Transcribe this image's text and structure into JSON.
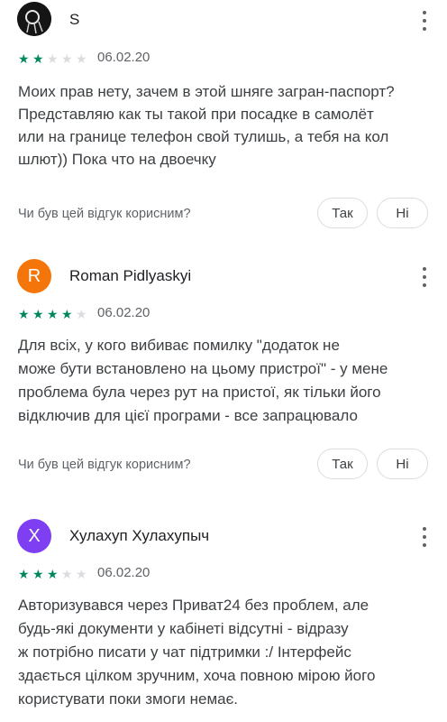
{
  "reviews": [
    {
      "author": "S",
      "avatar_letter": "",
      "avatar_color": "#1f1f1f",
      "rating": 2,
      "date": "06.02.20",
      "text": "Моих прав нету, зачем в этой шняге загран-паспорт?\nПредставляю как ты такой при посадке в самолёт\nили на границе телефон свой тулишь, а тебя на кол\nшлют)) Пока что на двоечку",
      "helpful_question": "Чи був цей відгук корисним?",
      "yes_label": "Так",
      "no_label": "Ні"
    },
    {
      "author": "Roman Pidlyaskyi",
      "avatar_letter": "R",
      "avatar_color": "#f4760b",
      "rating": 4,
      "date": "06.02.20",
      "text": "Для всіх, у кого вибиває помилку \"додаток не\nможе бути встановлено на цьому пристрої\" - у мене\nпроблема була через рут на пристої, як тільки його\nвідключив для цієї програми - все запрацювало",
      "helpful_question": "Чи був цей відгук корисним?",
      "yes_label": "Так",
      "no_label": "Ні"
    },
    {
      "author": "Хулахуп Хулахупыч",
      "avatar_letter": "X",
      "avatar_color": "#7e3ff2",
      "rating": 3,
      "date": "06.02.20",
      "text": "Авторизувався через Приват24 без проблем, але\nбудь-які документи у кабінеті відсутні - відразу\nж потрібно писати у чат підтримки :/ Інтерфейс\nздається цілком зручним, хоча повною мірою його\nкористувати поки змоги немає."
    }
  ]
}
